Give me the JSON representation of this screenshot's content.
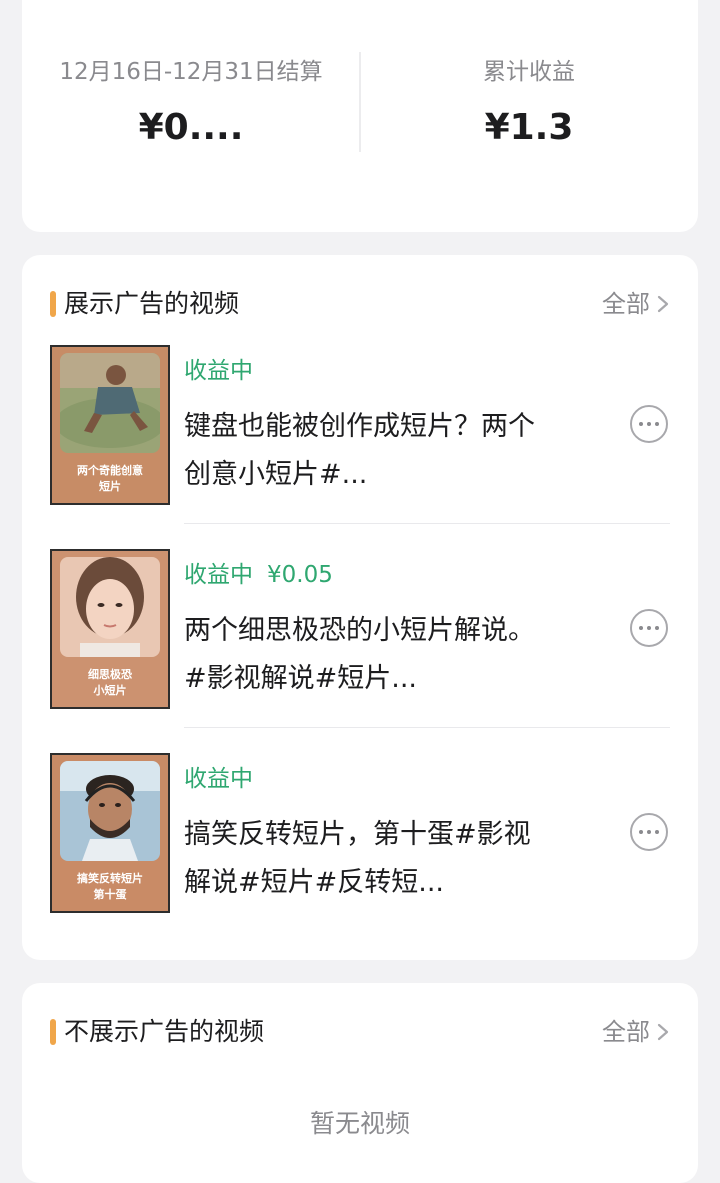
{
  "earnings": {
    "period_label": "12月16日-12月31日结算",
    "period_value": "¥0....",
    "total_label": "累计收益",
    "total_value": "¥1.3"
  },
  "ad_section": {
    "title": "展示广告的视频",
    "view_all": "全部",
    "items": [
      {
        "status": "收益中",
        "amount": "",
        "title": "键盘也能被创作成短片？两个创意小短片#...",
        "thumb_caption": "两个奇能创意\n短片"
      },
      {
        "status": "收益中",
        "amount": "¥0.05",
        "title": "两个细思极恐的小短片解说。#影视解说#短片...",
        "thumb_caption": "细思极恐\n小短片"
      },
      {
        "status": "收益中",
        "amount": "",
        "title": "搞笑反转短片，第十蛋#影视解说#短片#反转短...",
        "thumb_caption": "搞笑反转短片\n第十蛋"
      }
    ]
  },
  "noad_section": {
    "title": "不展示广告的视频",
    "view_all": "全部",
    "empty": "暂无视频"
  },
  "colors": {
    "accent": "#f0a64a",
    "status_green": "#2fa770",
    "background": "#f2f2f4"
  }
}
